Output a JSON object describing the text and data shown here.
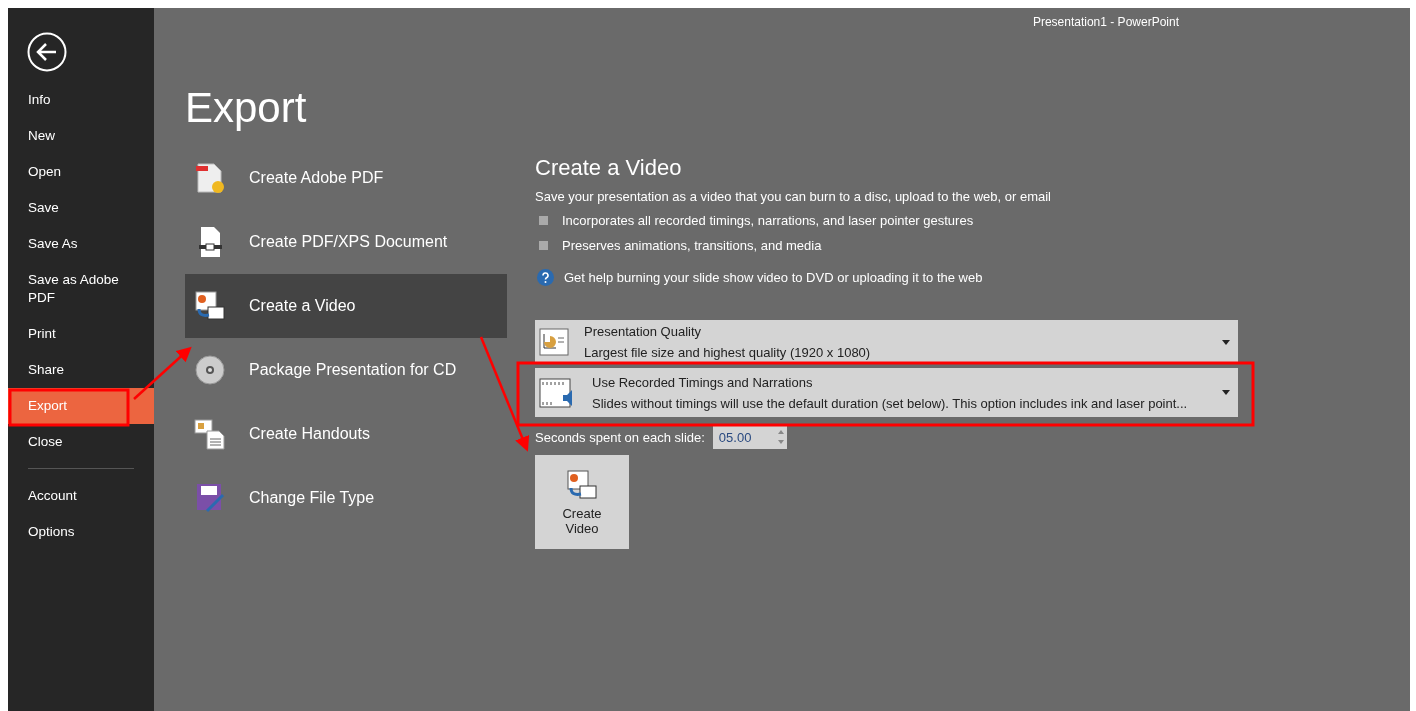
{
  "window": {
    "title": "Presentation1 - PowerPoint"
  },
  "sidebar": {
    "items": [
      {
        "label": "Info",
        "selected": false
      },
      {
        "label": "New",
        "selected": false
      },
      {
        "label": "Open",
        "selected": false
      },
      {
        "label": "Save",
        "selected": false
      },
      {
        "label": "Save As",
        "selected": false
      },
      {
        "label": "Save as Adobe PDF",
        "selected": false
      },
      {
        "label": "Print",
        "selected": false
      },
      {
        "label": "Share",
        "selected": false
      },
      {
        "label": "Export",
        "selected": true
      },
      {
        "label": "Close",
        "selected": false
      }
    ],
    "footer_items": [
      {
        "label": "Account",
        "selected": false
      },
      {
        "label": "Options",
        "selected": false
      }
    ]
  },
  "page_title": "Export",
  "export_options": [
    {
      "label": "Create Adobe PDF",
      "selected": false
    },
    {
      "label": "Create PDF/XPS Document",
      "selected": false
    },
    {
      "label": "Create a Video",
      "selected": true
    },
    {
      "label": "Package Presentation for CD",
      "selected": false
    },
    {
      "label": "Create Handouts",
      "selected": false
    },
    {
      "label": "Change File Type",
      "selected": false
    }
  ],
  "detail": {
    "title": "Create a Video",
    "description": "Save your presentation as a video that you can burn to a disc, upload to the web, or email",
    "bullets": [
      "Incorporates all recorded timings, narrations, and laser pointer gestures",
      "Preserves animations, transitions, and media"
    ],
    "help_link": "Get help burning your slide show video to DVD or uploading it to the web",
    "dropdowns": [
      {
        "title": "Presentation Quality",
        "description": "Largest file size and highest quality (1920 x 1080)"
      },
      {
        "title": "Use Recorded Timings and Narrations",
        "description": "Slides without timings will use the default duration (set below). This option includes ink and laser point..."
      }
    ],
    "seconds": {
      "label": "Seconds spent on each slide:",
      "value": "05.00"
    },
    "create_button": {
      "label": "Create Video"
    }
  }
}
